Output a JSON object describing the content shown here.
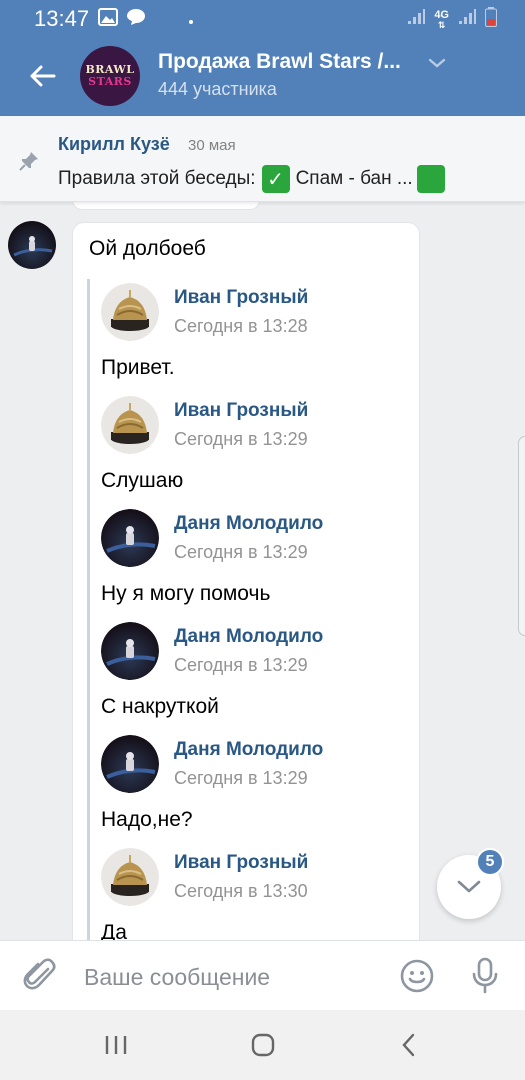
{
  "status_bar": {
    "time": "13:47",
    "network": "4G"
  },
  "header": {
    "back_icon": "arrow-left-icon",
    "avatar_line1": "BRAWL",
    "avatar_line2": "STARS",
    "title": "Продажа Brawl Stars /...",
    "members": "444 участника"
  },
  "pinned": {
    "author": "Кирилл Кузё",
    "date": "30 мая",
    "text_prefix": "Правила этой беседы:",
    "text_suffix": "Спам - бан ...",
    "check_glyph": "✓"
  },
  "message": {
    "text": "Ой долбоеб",
    "forwarded": [
      {
        "name": "Иван Грозный",
        "time": "Сегодня в 13:28",
        "text": "Привет.",
        "avatar": "cake"
      },
      {
        "name": "Иван Грозный",
        "time": "Сегодня в 13:29",
        "text": "Слушаю",
        "avatar": "cake"
      },
      {
        "name": "Даня Молодило",
        "time": "Сегодня в 13:29",
        "text": "Ну я могу помочь",
        "avatar": "space"
      },
      {
        "name": "Даня Молодило",
        "time": "Сегодня в 13:29",
        "text": "С накруткой",
        "avatar": "space"
      },
      {
        "name": "Даня Молодило",
        "time": "Сегодня в 13:29",
        "text": "Надо,не?",
        "avatar": "space"
      },
      {
        "name": "Иван Грозный",
        "time": "Сегодня в 13:30",
        "text": "Да",
        "avatar": "cake"
      }
    ]
  },
  "scroll_fab": {
    "badge": "5"
  },
  "composer": {
    "placeholder": "Ваше сообщение"
  },
  "colors": {
    "header": "#5181b8",
    "link": "#2a5885",
    "background": "#edeef0"
  }
}
